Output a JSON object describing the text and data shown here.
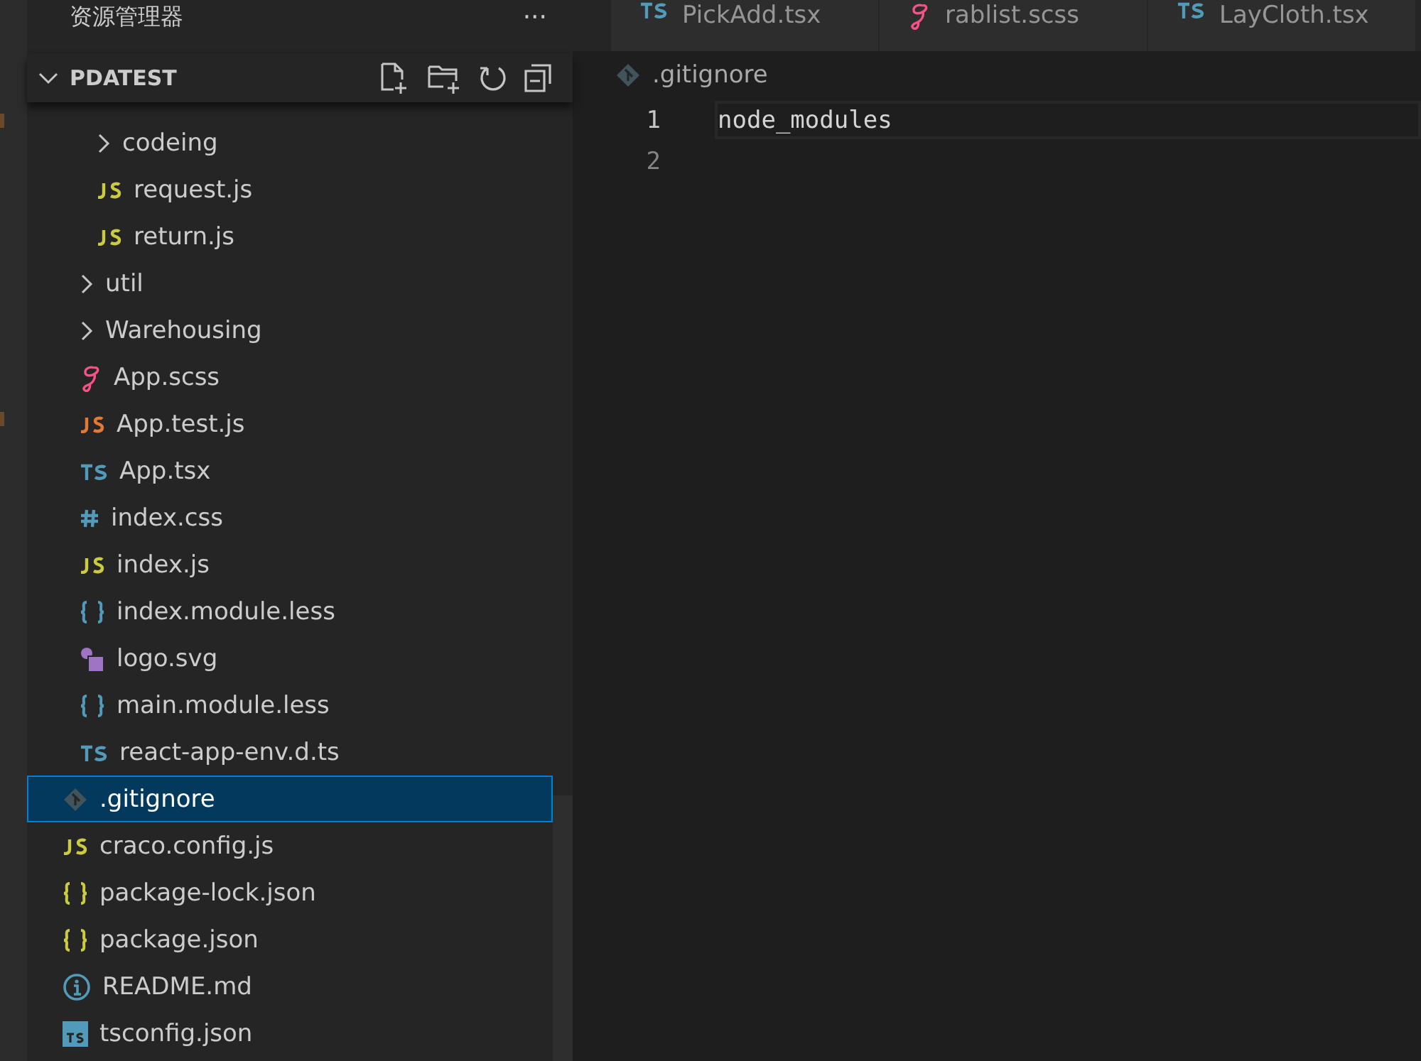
{
  "sidebar": {
    "title": "资源管理器",
    "more": "···",
    "section": {
      "label": "PDATEST",
      "expanded": true
    },
    "tree": [
      {
        "children": [
          {
            "children": [
              {
                "name": "codeing",
                "kind": "folder",
                "expanded": false,
                "selected": false
              },
              {
                "name": "request.js",
                "kind": "js",
                "selected": false
              },
              {
                "name": "return.js",
                "kind": "js",
                "selected": false
              }
            ]
          },
          {
            "name": "util",
            "kind": "folder",
            "expanded": false,
            "selected": false
          },
          {
            "name": "Warehousing",
            "kind": "folder",
            "expanded": false,
            "selected": false
          },
          {
            "name": "App.scss",
            "kind": "scss",
            "selected": false
          },
          {
            "name": "App.test.js",
            "kind": "test",
            "selected": false
          },
          {
            "name": "App.tsx",
            "kind": "ts",
            "selected": false
          },
          {
            "name": "index.css",
            "kind": "css",
            "selected": false
          },
          {
            "name": "index.js",
            "kind": "js",
            "selected": false
          },
          {
            "name": "index.module.less",
            "kind": "less",
            "selected": false
          },
          {
            "name": "logo.svg",
            "kind": "svg",
            "selected": false
          },
          {
            "name": "main.module.less",
            "kind": "less",
            "selected": false
          },
          {
            "name": "react-app-env.d.ts",
            "kind": "ts",
            "selected": false
          }
        ]
      },
      {
        "name": ".gitignore",
        "kind": "git",
        "selected": true
      },
      {
        "name": "craco.config.js",
        "kind": "js",
        "selected": false
      },
      {
        "name": "package-lock.json",
        "kind": "json",
        "selected": false
      },
      {
        "name": "package.json",
        "kind": "json",
        "selected": false
      },
      {
        "name": "README.md",
        "kind": "info",
        "selected": false
      },
      {
        "name": "tsconfig.json",
        "kind": "tsconfig",
        "selected": false
      }
    ]
  },
  "tabs": [
    {
      "label": "PickAdd.tsx",
      "kind": "ts",
      "selected": false
    },
    {
      "label": "rablist.scss",
      "kind": "scss",
      "selected": false
    },
    {
      "label": "LayCloth.tsx",
      "kind": "ts",
      "selected": false
    }
  ],
  "editor": {
    "breadcrumb": ".gitignore",
    "lines": [
      {
        "number": "1",
        "text": "node_modules",
        "current": true
      },
      {
        "number": "2",
        "current": false
      }
    ]
  }
}
